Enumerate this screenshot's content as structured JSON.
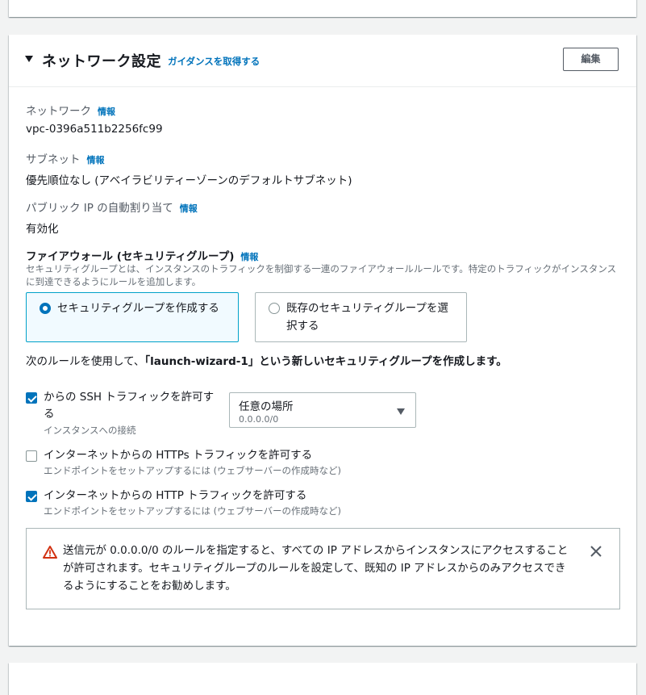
{
  "section": {
    "title": "ネットワーク設定",
    "guide_link": "ガイダンスを取得する",
    "edit_button": "編集"
  },
  "info_label": "情報",
  "fields": {
    "network": {
      "label": "ネットワーク",
      "value": "vpc-0396a511b2256fc99"
    },
    "subnet": {
      "label": "サブネット",
      "value": "優先順位なし (アベイラビリティーゾーンのデフォルトサブネット)"
    },
    "public_ip": {
      "label": "パブリック IP の自動割り当て",
      "value": "有効化"
    }
  },
  "firewall": {
    "title": "ファイアウォール (セキュリティグループ)",
    "description": "セキュリティグループとは、インスタンスのトラフィックを制御する一連のファイアウォールルールです。特定のトラフィックがインスタンスに到達できるようにルールを追加します。",
    "options": [
      {
        "label": "セキュリティグループを作成する",
        "selected": true
      },
      {
        "label": "既存のセキュリティグループを選択する",
        "selected": false
      }
    ],
    "rule_note_prefix": "次のルールを使用して、",
    "rule_note_bold": "「launch-wizard-1」という新しいセキュリティグループを作成します。"
  },
  "rules": [
    {
      "label": "からの SSH トラフィックを許可する",
      "desc": "インスタンスへの接続",
      "checked": true
    },
    {
      "label": "インターネットからの HTTPs トラフィックを許可する",
      "desc": "エンドポイントをセットアップするには (ウェブサーバーの作成時など)",
      "checked": false
    },
    {
      "label": "インターネットからの HTTP トラフィックを許可する",
      "desc": "エンドポイントをセットアップするには (ウェブサーバーの作成時など)",
      "checked": true
    }
  ],
  "ssh_source": {
    "selected": "任意の場所",
    "cidr": "0.0.0.0/0"
  },
  "alert": {
    "text": "送信元が 0.0.0.0/0 のルールを指定すると、すべての IP アドレスからインスタンスにアクセスすることが許可されます。セキュリティグループのルールを設定して、既知の IP アドレスからのみアクセスできるようにすることをお勧めします。"
  },
  "colors": {
    "link": "#0073bb",
    "warning": "#d13212",
    "selected_border": "#00a1c9",
    "selected_bg": "#f1faff"
  },
  "icons": [
    "caret-down-icon",
    "checkbox-icon",
    "radio-icon",
    "warning-icon",
    "close-icon",
    "dropdown-caret-icon"
  ]
}
